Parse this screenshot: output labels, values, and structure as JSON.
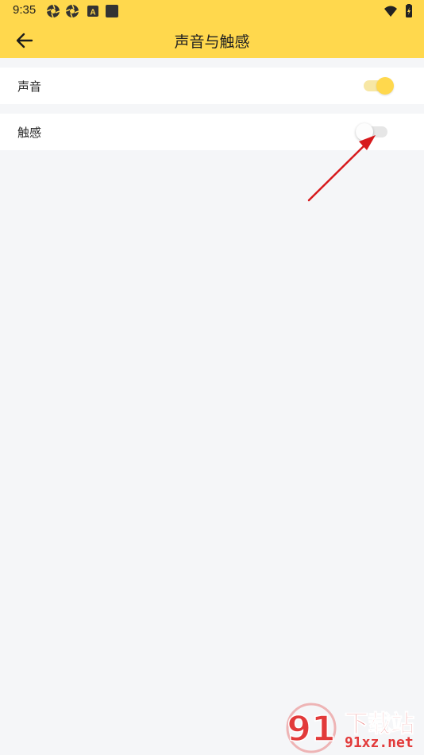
{
  "status_bar": {
    "time": "9:35",
    "left_icons": [
      "aperture-icon",
      "aperture-icon",
      "font-a-icon",
      "square-app-icon"
    ],
    "font_icon_glyph": "A",
    "right_icons": [
      "wifi-icon",
      "battery-charging-icon"
    ]
  },
  "app_bar": {
    "back_icon": "arrow-left-icon",
    "title": "声音与触感"
  },
  "settings": [
    {
      "label": "声音",
      "enabled": true
    },
    {
      "label": "触感",
      "enabled": false
    }
  ],
  "watermark": {
    "logo_text": "91",
    "cn_text": "下载站",
    "url_text": "91xz.net"
  },
  "colors": {
    "header_yellow": "#ffd84d",
    "background": "#f5f6f8",
    "switch_on_track": "#f7e7a5",
    "switch_on_knob": "#ffd84d",
    "switch_off_track": "#e6e6e6",
    "annotation_red": "#d7191c",
    "watermark_red": "#e23a3a"
  }
}
